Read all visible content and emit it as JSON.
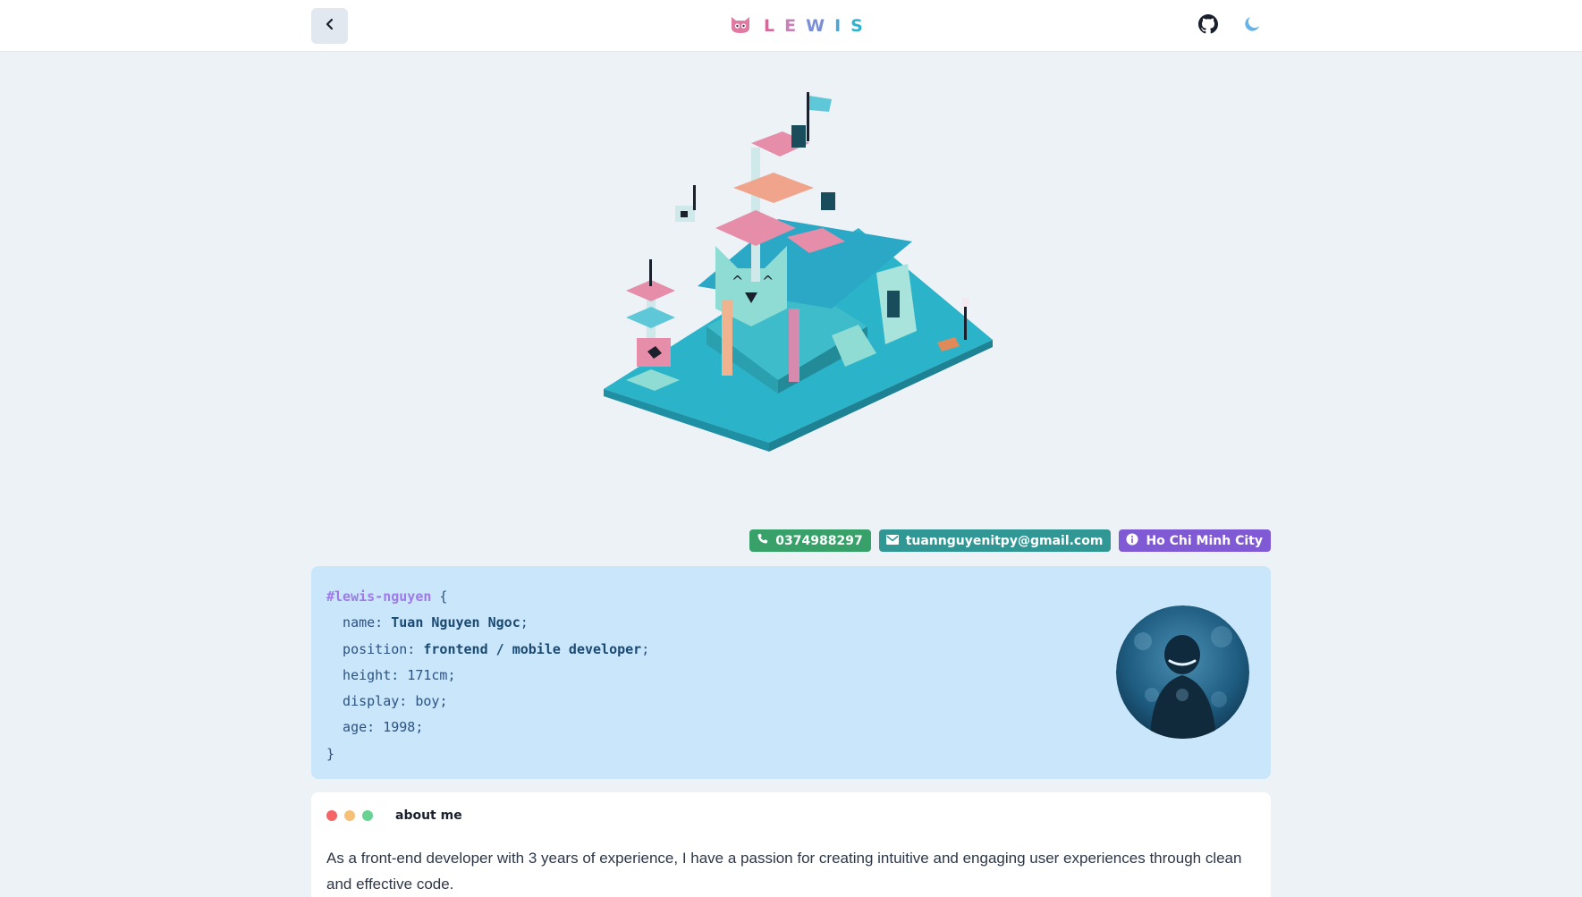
{
  "header": {
    "back_icon": "chevron-left-icon",
    "logo_icon": "cat-face-icon",
    "brand_letters": [
      "L",
      "E",
      "W",
      "I",
      "S"
    ],
    "github_icon": "github-icon",
    "theme_icon": "moon-icon"
  },
  "hero": {
    "illustration": "isometric-cat-house-voxel-scene"
  },
  "badges": {
    "phone": "0374988297",
    "email": "tuannguyenitpy@gmail.com",
    "location": "Ho Chi Minh City"
  },
  "profile_code": {
    "selector": "#lewis-nguyen",
    "open_brace": " {",
    "name_key": "  name: ",
    "name_value": "Tuan Nguyen Ngoc",
    "position_key": "  position: ",
    "position_value": "frontend / mobile developer",
    "height_key": "  height: ",
    "height_value": "171cm",
    "display_key": "  display: ",
    "display_value": "boy",
    "age_key": "  age: ",
    "age_value": "1998",
    "semicolon": ";",
    "close_brace": "}"
  },
  "about": {
    "title": "about me",
    "text": "As a front-end developer with 3 years of experience, I have a passion for creating intuitive and engaging user experiences through clean and effective code."
  },
  "colors": {
    "page_bg": "#edf2f7",
    "code_card_bg": "#c9e6fb",
    "phone_badge": "#38a169",
    "mail_badge": "#319795",
    "location_badge": "#805ad5",
    "selector": "#9f7aea"
  }
}
